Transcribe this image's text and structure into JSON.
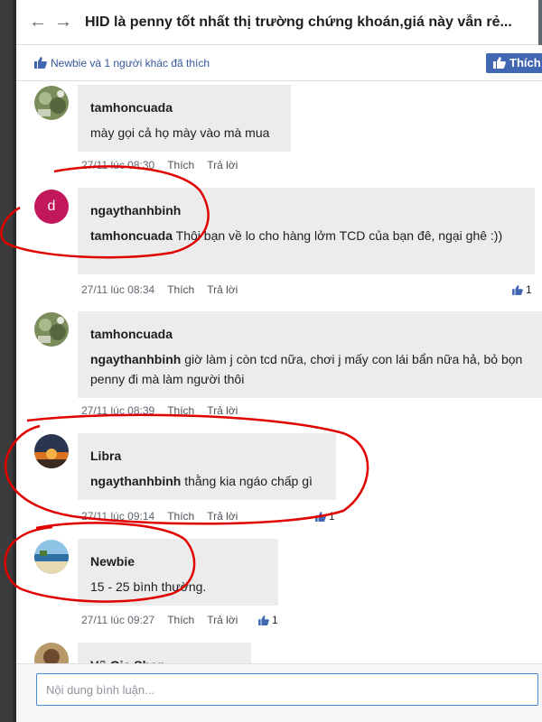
{
  "titlebar": {
    "back_icon": "arrow-left-icon",
    "forward_icon": "arrow-right-icon",
    "title": "HID là penny tốt nhất thị trường chứng khoán,giá này vẫn rẻ..."
  },
  "likes": {
    "summary": "Newbie và 1 người khác đã thích",
    "like_button": "Thích",
    "icon": "thumbs-up-icon"
  },
  "comments": [
    {
      "author": "tamhoncuada",
      "mention": "",
      "text": "mày gọi cả họ mày vào mà mua",
      "time": "27/11 lúc 08:30",
      "like": "Thích",
      "reply": "Trả lời",
      "reactions": ""
    },
    {
      "author": "ngaythanhbinh",
      "avatar_letter": "d",
      "mention": "tamhoncuada",
      "text": " Thôi bạn về lo cho hàng lởm TCD của bạn đê, ngại ghê :))",
      "time": "27/11 lúc 08:34",
      "like": "Thích",
      "reply": "Trả lời",
      "reactions": "1"
    },
    {
      "author": "tamhoncuada",
      "mention": "ngaythanhbinh",
      "text": " giờ làm j còn tcd nữa, chơi j mấy con lái bẩn nữa hả, bỏ bọn penny đi mà làm người thôi",
      "time": "27/11 lúc 08:39",
      "like": "Thích",
      "reply": "Trả lời",
      "reactions": ""
    },
    {
      "author": "Libra",
      "mention": "ngaythanhbinh",
      "text": " thằng kia ngáo chấp gì",
      "time": "27/11 lúc 09:14",
      "like": "Thích",
      "reply": "Trả lời",
      "reactions": "1"
    },
    {
      "author": "Newbie",
      "mention": "",
      "text": "15 - 25 bình thường.",
      "time": "27/11 lúc 09:27",
      "like": "Thích",
      "reply": "Trả lời",
      "reactions": "1"
    },
    {
      "author": "Vũ Gia Shop",
      "mention": "",
      "text": "",
      "time": "",
      "like": "",
      "reply": "",
      "reactions": ""
    }
  ],
  "input": {
    "placeholder": "Nội dung bình luận..."
  },
  "colors": {
    "accent": "#4267b2",
    "link": "#365899",
    "bubble": "#ececec",
    "annotation": "#e00000",
    "avatar_letter_bg": "#c2185b"
  }
}
